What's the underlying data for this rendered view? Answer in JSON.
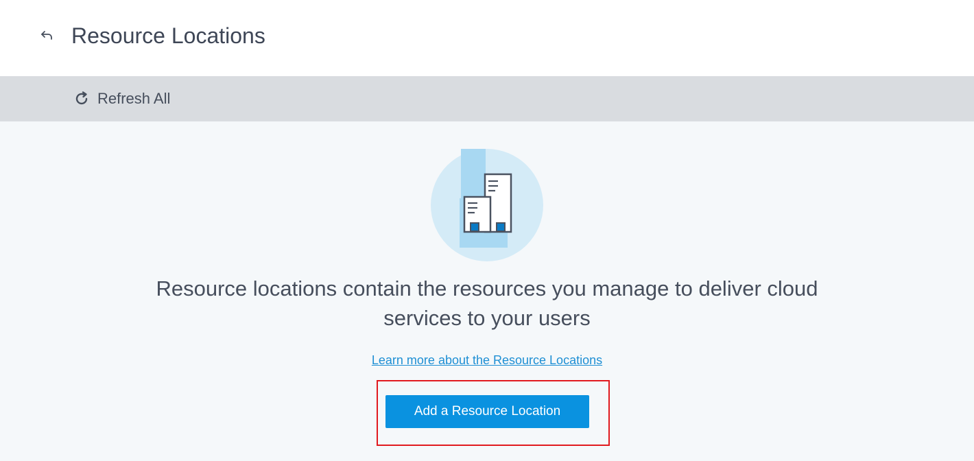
{
  "header": {
    "title": "Resource Locations",
    "back_icon": "back-arrow-icon"
  },
  "toolbar": {
    "refresh_label": "Refresh All",
    "refresh_icon": "refresh-icon"
  },
  "empty_state": {
    "illustration_icon": "buildings-icon",
    "description": "Resource locations contain the resources you manage to deliver cloud services to your users",
    "learn_more_link": "Learn more about the Resource Locations",
    "add_button_label": "Add a Resource Location"
  },
  "colors": {
    "accent": "#0a92e0",
    "link": "#1e8fd4",
    "highlight": "#e1191e",
    "toolbar_bg": "#d9dce0",
    "illustration_bg": "#d4ebf7"
  }
}
